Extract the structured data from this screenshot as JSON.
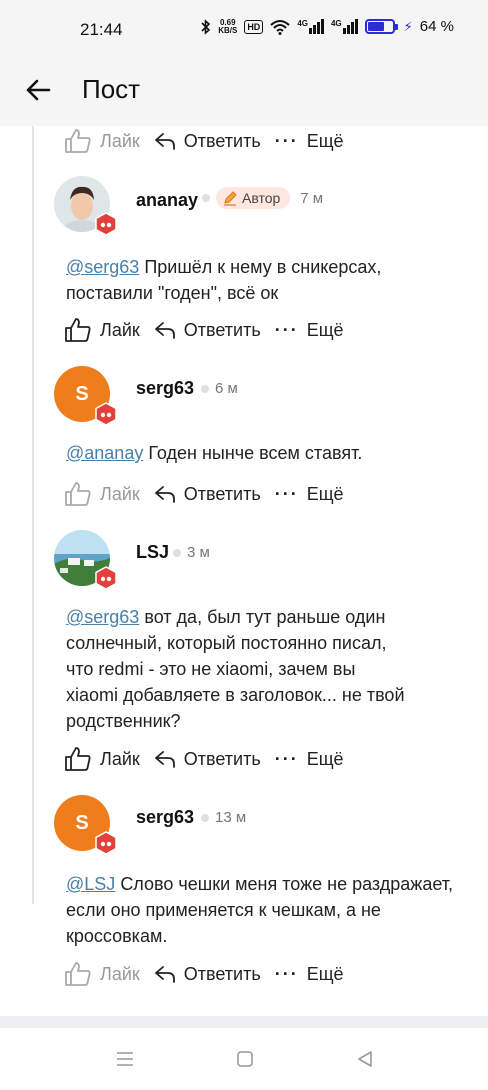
{
  "status_bar": {
    "time": "21:44",
    "net_speed_value": "0.69",
    "net_speed_unit": "KB/S",
    "hd_label": "HD",
    "sig1": "4G",
    "sig2": "4G",
    "battery_text": "64 %",
    "battery_level": 0.64
  },
  "header": {
    "title": "Пост"
  },
  "actions": {
    "like": "Лайк",
    "reply": "Ответить",
    "more": "Ещё"
  },
  "comments": [
    {
      "author": "ananay",
      "author_badge": "Автор",
      "time": "7 м",
      "mention": "@serg63",
      "text_lines": [
        "Пришёл к нему в сникерсах,",
        "поставили \"годен\", всё ок"
      ]
    },
    {
      "author": "serg63",
      "avatar_letter": "S",
      "time": "6 м",
      "mention": "@ananay",
      "text_lines": [
        "Годен нынче всем ставят."
      ]
    },
    {
      "author": "LSJ",
      "time": "3 м",
      "mention": "@serg63",
      "text_lines": [
        "вот да, был тут раньше один",
        "солнечный, который постоянно писал,",
        "что redmi - это не xiaomi, зачем вы",
        "xiaomi добавляете в заголовок... не твой",
        "родственник?"
      ]
    },
    {
      "author": "serg63",
      "avatar_letter": "S",
      "time": "13 м",
      "mention": "@LSJ",
      "text_lines": [
        "Слово чешки меня тоже не раздражает,",
        "если оно применяется к чешкам, а не",
        "кроссовкам."
      ]
    }
  ],
  "icons": {
    "back": "arrow-left-icon",
    "like": "thumbs-up-icon",
    "reply": "reply-arrow-icon",
    "more": "more-dots-icon",
    "badge": "level-badge-icon",
    "nav_menu": "menu-icon",
    "nav_home": "square-icon",
    "nav_back": "triangle-back-icon"
  },
  "colors": {
    "accent_orange": "#ef7d1c",
    "badge_red": "#e2403b",
    "mention": "#4a7fa7",
    "author_pill_bg": "#fde7e0"
  }
}
